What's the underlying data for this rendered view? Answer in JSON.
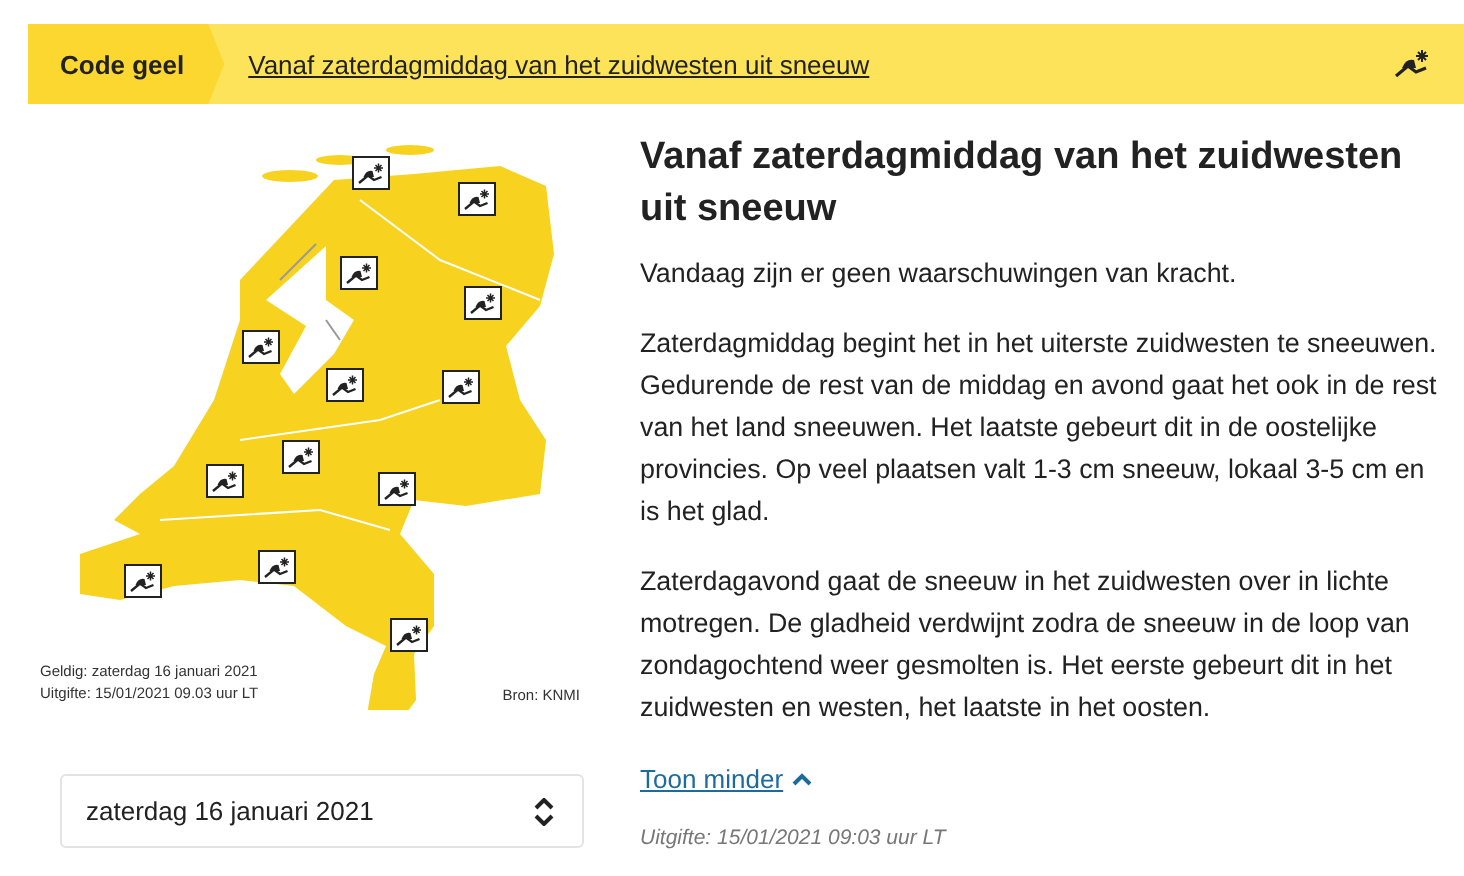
{
  "banner": {
    "level": "Code geel",
    "headline": "Vanaf zaterdagmiddag van het zuidwesten uit sneeuw"
  },
  "map": {
    "valid": "Geldig: zaterdag 16 januari 2021",
    "issued": "Uitgifte: 15/01/2021 09.03 uur LT",
    "source": "Bron: KNMI"
  },
  "date_select": {
    "value": "zaterdag 16 januari 2021"
  },
  "article": {
    "title": "Vanaf zaterdagmiddag van het zuidwesten uit sneeuw",
    "paragraphs": [
      "Vandaag zijn er geen waarschuwingen van kracht.",
      "Zaterdagmiddag begint het in het uiterste zuidwesten te sneeuwen. Gedurende de rest van de middag en avond gaat het ook in de rest van het land sneeuwen. Het laatste gebeurt dit in de oostelijke provincies. Op veel plaatsen valt 1-3 cm sneeuw, lokaal 3-5 cm en is het glad.",
      "Zaterdagavond gaat de sneeuw in het zuidwesten over in lichte motregen. De gladheid verdwijnt zodra de sneeuw in de loop van zondagochtend weer gesmolten is. Het eerste gebeurt dit in het zuidwesten en westen, het laatste in het oosten."
    ],
    "toggle": "Toon minder",
    "issued": "Uitgifte: 15/01/2021 09:03 uur LT"
  }
}
